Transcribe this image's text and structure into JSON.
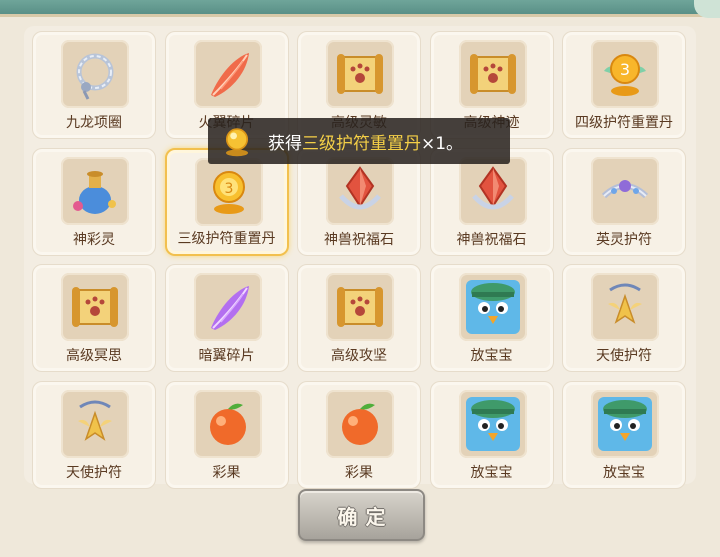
{
  "toast": {
    "prefix": "获得",
    "item": "三级护符重置丹",
    "suffix": "×1。"
  },
  "items": [
    {
      "label": "九龙项圈",
      "icon": "necklace-icon"
    },
    {
      "label": "火翼碎片",
      "icon": "red-feather-icon"
    },
    {
      "label": "高级灵敏",
      "icon": "scroll-icon"
    },
    {
      "label": "高级神迹",
      "icon": "scroll-icon"
    },
    {
      "label": "四级护符重置丹",
      "icon": "gold-orb-4-icon"
    },
    {
      "label": "神彩灵",
      "icon": "vase-icon"
    },
    {
      "label": "三级护符重置丹",
      "icon": "gold-orb-3-icon"
    },
    {
      "label": "神兽祝福石",
      "icon": "blessing-stone-icon"
    },
    {
      "label": "神兽祝福石",
      "icon": "blessing-stone-icon"
    },
    {
      "label": "英灵护符",
      "icon": "tiara-icon"
    },
    {
      "label": "高级冥思",
      "icon": "scroll-icon"
    },
    {
      "label": "暗翼碎片",
      "icon": "purple-feather-icon"
    },
    {
      "label": "高级攻坚",
      "icon": "scroll-icon"
    },
    {
      "label": "放宝宝",
      "icon": "bird-pet-icon"
    },
    {
      "label": "天使护符",
      "icon": "angel-charm-icon"
    },
    {
      "label": "天使护符",
      "icon": "angel-charm-icon"
    },
    {
      "label": "彩果",
      "icon": "fruit-icon"
    },
    {
      "label": "彩果",
      "icon": "fruit-icon"
    },
    {
      "label": "放宝宝",
      "icon": "bird-pet-icon"
    },
    {
      "label": "放宝宝",
      "icon": "bird-pet-icon"
    }
  ],
  "selected_index": 6,
  "confirm_label": "确定",
  "colors": {
    "label_text": "#5a3a22",
    "highlight": "#f5d047",
    "selected_border": "#f2c04e"
  }
}
